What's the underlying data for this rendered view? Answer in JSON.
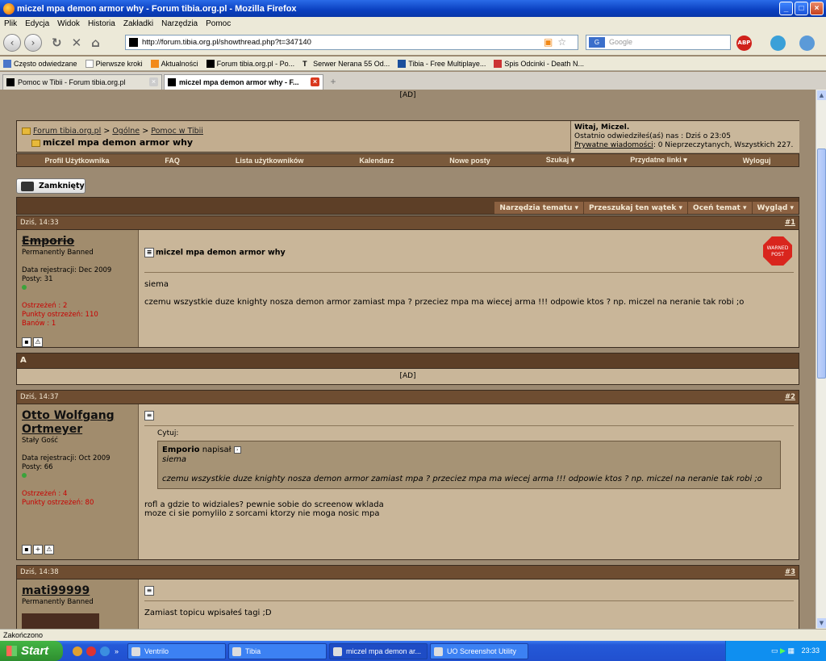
{
  "window": {
    "title": "miczel mpa demon armor why - Forum tibia.org.pl - Mozilla Firefox"
  },
  "menu": [
    "Plik",
    "Edycja",
    "Widok",
    "Historia",
    "Zakładki",
    "Narzędzia",
    "Pomoc"
  ],
  "url": "http://forum.tibia.org.pl/showthread.php?t=347140",
  "search_placeholder": "Google",
  "addons": {
    "abp": "ABP"
  },
  "bookmarks": [
    "Często odwiedzane",
    "Pierwsze kroki",
    "Aktualności",
    "Forum tibia.org.pl - Po...",
    "Serwer Nerana 55 Od...",
    "Tibia - Free Multiplaye...",
    "Spis Odcinki - Death N..."
  ],
  "tabs": [
    {
      "label": "Pomoc w Tibii - Forum tibia.org.pl"
    },
    {
      "label": "miczel mpa demon armor why - F..."
    }
  ],
  "ad_label": "[AD]",
  "breadcrumb": {
    "site": "Forum tibia.org.pl",
    "sep": ">",
    "cat1": "Ogólne",
    "cat2": "Pomoc w Tibii",
    "thread": "miczel mpa demon armor why"
  },
  "userbox": {
    "greeting": "Witaj, Miczel.",
    "last_visit": "Ostatnio odwiedziłeś(aś) nas : Dziś o 23:05",
    "pm_link": "Prywatne wiadomości",
    "pm_text": ": 0 Nieprzeczytanych, Wszystkich 227."
  },
  "nav": [
    "Profil Użytkownika",
    "FAQ",
    "Lista użytkowników",
    "Kalendarz",
    "Nowe posty",
    "Szukaj ▾",
    "Przydatne linki ▾",
    "Wyloguj"
  ],
  "closed_label": "Zamknięty",
  "thread_tools": [
    "Narzędzia tematu ▾",
    "Przeszukaj ten wątek ▾",
    "Oceń temat ▾",
    "Wygląd ▾"
  ],
  "sep_letter": "A",
  "posts": [
    {
      "time": "Dziś, 14:33",
      "num": "#1",
      "user": "Emporio",
      "rank": "Permanently Banned",
      "reg": "Data rejestracji: Dec 2009",
      "posts": "Posty: 31",
      "warn1": "Ostrzeżeń : 2",
      "warn2": "Punkty ostrzeżeń: 110",
      "warn3": "Banów : 1",
      "title": "miczel mpa demon armor why",
      "badge": "WARNED POST",
      "line1": "siema",
      "line2": "czemu wszystkie duze knighty nosza demon armor zamiast mpa ? przeciez mpa ma wiecej arma !!! odpowie ktos ? np. miczel na neranie tak robi ;o"
    },
    {
      "time": "Dziś, 14:37",
      "num": "#2",
      "user_l1": "Otto Wolfgang",
      "user_l2": "Ortmeyer",
      "rank": "Stały Gość",
      "reg": "Data rejestracji: Oct 2009",
      "posts": "Posty: 66",
      "warn1": "Ostrzeżeń : 4",
      "warn2": "Punkty ostrzeżeń: 80",
      "quote_label": "Cytuj:",
      "quote_author": "Emporio",
      "quote_wrote": "napisał",
      "quote_l1": "siema",
      "quote_l2": "czemu wszystkie duze knighty nosza demon armor zamiast mpa ? przeciez mpa ma wiecej arma !!! odpowie ktos ? np. miczel na neranie tak robi ;o",
      "line1": "rofl a gdzie to widziales? pewnie sobie do screenow wklada",
      "line2": "moze ci sie pomylilo z sorcami ktorzy nie moga nosic mpa"
    },
    {
      "time": "Dziś, 14:38",
      "num": "#3",
      "user": "mati99999",
      "rank": "Permanently Banned",
      "line1": "Zamiast topicu wpisałeś tagi ;D"
    }
  ],
  "status": "Zakończono",
  "taskbar": {
    "start": "Start",
    "tasks": [
      "Ventrilo",
      "Tibia",
      "miczel mpa demon ar...",
      "UO Screenshot Utility"
    ],
    "clock": "23:33"
  }
}
